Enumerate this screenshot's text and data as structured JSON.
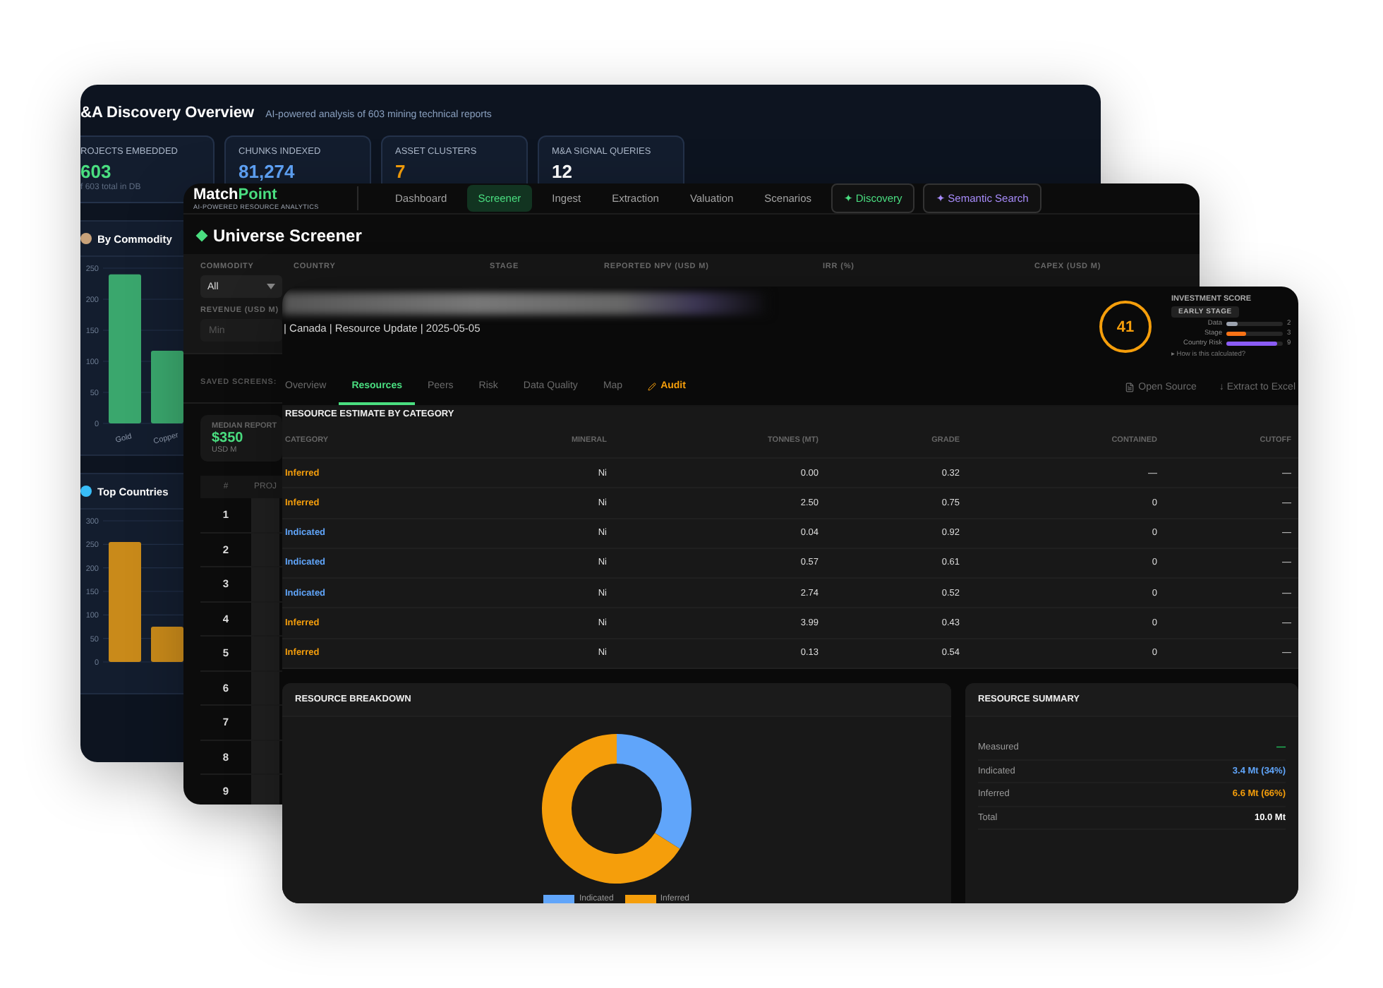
{
  "discovery_window": {
    "title": "&A Discovery Overview",
    "subtitle": "AI-powered analysis of 603 mining technical reports",
    "stats": [
      {
        "label": "ROJECTS EMBEDDED",
        "value": "603",
        "note": "f 603 total in DB",
        "color": "#4ade80"
      },
      {
        "label": "CHUNKS INDEXED",
        "value": "81,274",
        "color": "#60a5fa"
      },
      {
        "label": "ASSET CLUSTERS",
        "value": "7",
        "color": "#f59e0b"
      },
      {
        "label": "M&A SIGNAL QUERIES",
        "value": "12",
        "color": "#ffffff"
      }
    ],
    "panels": [
      {
        "title": "By Commodity",
        "kind": "commodity",
        "chart_data": {
          "type": "bar",
          "categories": [
            "Gold",
            "Copper"
          ],
          "yticks": [
            0,
            50,
            100,
            150,
            200,
            250
          ],
          "ylim": [
            0,
            250
          ],
          "grid": true,
          "series": [
            {
              "color": "#3aa76d",
              "values": [
                240,
                117
              ]
            }
          ]
        }
      },
      {
        "title": "Top Countries",
        "kind": "countries",
        "chart_data": {
          "type": "bar",
          "yticks": [
            0,
            50,
            100,
            150,
            200,
            250,
            300
          ],
          "ylim": [
            0,
            300
          ],
          "grid": true,
          "series": [
            {
              "color": "#c98a1a",
              "values": [
                255,
                75
              ]
            }
          ]
        }
      }
    ]
  },
  "screener_window": {
    "logo": {
      "first": "Match",
      "second": "Point",
      "tagline": "AI-POWERED RESOURCE ANALYTICS"
    },
    "nav": [
      {
        "label": "Dashboard",
        "selected": false
      },
      {
        "label": "Screener",
        "selected": true
      },
      {
        "label": "Ingest",
        "selected": false
      },
      {
        "label": "Extraction",
        "selected": false
      },
      {
        "label": "Valuation",
        "selected": false
      },
      {
        "label": "Scenarios",
        "selected": false
      }
    ],
    "nav_buttons": [
      {
        "label": "✦ Discovery",
        "color": "#4ade80"
      },
      {
        "label": "✦ Semantic Search",
        "color": "#a78bfa"
      }
    ],
    "page_title": "Universe Screener",
    "filters": [
      {
        "label": "COMMODITY",
        "value": "All"
      },
      {
        "label": "COUNTRY"
      },
      {
        "label": "STAGE"
      },
      {
        "label": "REPORTED NPV (USD M)"
      },
      {
        "label": "IRR (%)"
      },
      {
        "label": "CAPEX (USD M)"
      }
    ],
    "revenue": {
      "label": "REVENUE (USD M)",
      "placeholder": "Min"
    },
    "saved_screens": "SAVED SCREENS:",
    "median": {
      "label": "MEDIAN REPORT",
      "value": "$350",
      "unit": "USD M"
    },
    "table": {
      "columns": [
        "#",
        "PROJ"
      ],
      "rows": [
        "1",
        "2",
        "3",
        "4",
        "5",
        "6",
        "7",
        "8",
        "9"
      ]
    }
  },
  "project_window": {
    "meta": "| Canada | Resource Update | 2025-05-05",
    "score": "41",
    "score_title": "INVESTMENT SCORE",
    "stage": "EARLY STAGE",
    "score_bars": [
      {
        "label": "Data",
        "level": 0.2,
        "value": "2",
        "color": "#9ca3af"
      },
      {
        "label": "Stage",
        "level": 0.35,
        "value": "3",
        "color": "#f97316"
      },
      {
        "label": "Country Risk",
        "level": 0.9,
        "value": "9",
        "color": "#8b5cf6"
      }
    ],
    "how": "▸ How is this calculated?",
    "tabs": [
      {
        "label": "Overview",
        "selected": false,
        "kind": "plain"
      },
      {
        "label": "Resources",
        "selected": true,
        "kind": "plain"
      },
      {
        "label": "Peers",
        "selected": false,
        "kind": "plain"
      },
      {
        "label": "Risk",
        "selected": false,
        "kind": "plain"
      },
      {
        "label": "Data Quality",
        "selected": false,
        "kind": "plain"
      },
      {
        "label": "Map",
        "selected": false,
        "kind": "plain"
      },
      {
        "label": "Audit",
        "selected": false,
        "kind": "audit"
      }
    ],
    "actions": [
      {
        "label": "Open Source",
        "kind": "document"
      },
      {
        "label": "↓ Extract to Excel",
        "kind": "plain"
      }
    ],
    "section_title": "RESOURCE ESTIMATE BY CATEGORY",
    "table": {
      "columns": [
        "CATEGORY",
        "MINERAL",
        "TONNES (MT)",
        "GRADE",
        "CONTAINED",
        "CUTOFF"
      ],
      "rows": [
        {
          "color": "#f59e0b",
          "cells": [
            "Inferred",
            "Ni",
            "0.00",
            "0.32",
            "—",
            "—"
          ]
        },
        {
          "color": "#f59e0b",
          "cells": [
            "Inferred",
            "Ni",
            "2.50",
            "0.75",
            "0",
            "—"
          ]
        },
        {
          "color": "#60a5fa",
          "cells": [
            "Indicated",
            "Ni",
            "0.04",
            "0.92",
            "0",
            "—"
          ]
        },
        {
          "color": "#60a5fa",
          "cells": [
            "Indicated",
            "Ni",
            "0.57",
            "0.61",
            "0",
            "—"
          ]
        },
        {
          "color": "#60a5fa",
          "cells": [
            "Indicated",
            "Ni",
            "2.74",
            "0.52",
            "0",
            "—"
          ]
        },
        {
          "color": "#f59e0b",
          "cells": [
            "Inferred",
            "Ni",
            "3.99",
            "0.43",
            "0",
            "—"
          ]
        },
        {
          "color": "#f59e0b",
          "cells": [
            "Inferred",
            "Ni",
            "0.13",
            "0.54",
            "0",
            "—"
          ]
        }
      ]
    },
    "breakdown": {
      "title": "RESOURCE BREAKDOWN",
      "chart_data": {
        "type": "donut",
        "categories": [
          "Indicated",
          "Inferred"
        ],
        "series": [
          {
            "values": [
              34,
              66
            ]
          }
        ],
        "colors": [
          "#60a5fa",
          "#f59e0b"
        ]
      }
    },
    "summary": {
      "title": "RESOURCE SUMMARY",
      "rows": [
        {
          "label": "Measured",
          "value": "—",
          "color": "#22c55e"
        },
        {
          "label": "Indicated",
          "value": "3.4 Mt (34%)",
          "color": "#60a5fa"
        },
        {
          "label": "Inferred",
          "value": "6.6 Mt (66%)",
          "color": "#f59e0b"
        },
        {
          "label": "Total",
          "value": "10.0 Mt",
          "color": "#ffffff"
        }
      ]
    }
  }
}
